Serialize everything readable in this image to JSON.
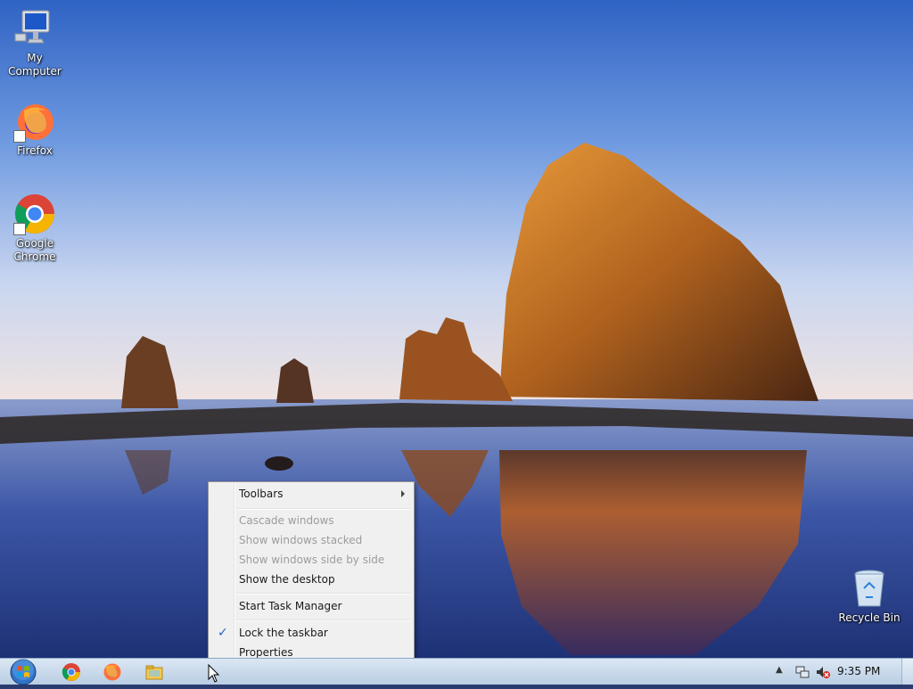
{
  "desktop": {
    "icons": [
      {
        "label": "My Computer"
      },
      {
        "label": "Firefox"
      },
      {
        "label": "Google Chrome"
      },
      {
        "label": "Recycle Bin"
      }
    ]
  },
  "context_menu": {
    "items": [
      {
        "label": "Toolbars",
        "has_submenu": true,
        "enabled": true
      },
      {
        "label": "Cascade windows",
        "enabled": false
      },
      {
        "label": "Show windows stacked",
        "enabled": false
      },
      {
        "label": "Show windows side by side",
        "enabled": false
      },
      {
        "label": "Show the desktop",
        "enabled": true
      },
      {
        "label": "Start Task Manager",
        "enabled": true
      },
      {
        "label": "Lock the taskbar",
        "checked": true,
        "enabled": true
      },
      {
        "label": "Properties",
        "enabled": true
      }
    ]
  },
  "taskbar": {
    "apps": [
      "chrome-icon",
      "firefox-icon",
      "file-explorer-icon"
    ],
    "tray_icons": [
      "show-hidden-icons-arrow",
      "network-icon",
      "volume-muted-icon"
    ],
    "clock": "9:35 PM"
  },
  "colors": {
    "check_accent": "#2760c4",
    "taskbar_top": "#dbe7f4",
    "taskbar_bottom": "#b9cde3"
  }
}
